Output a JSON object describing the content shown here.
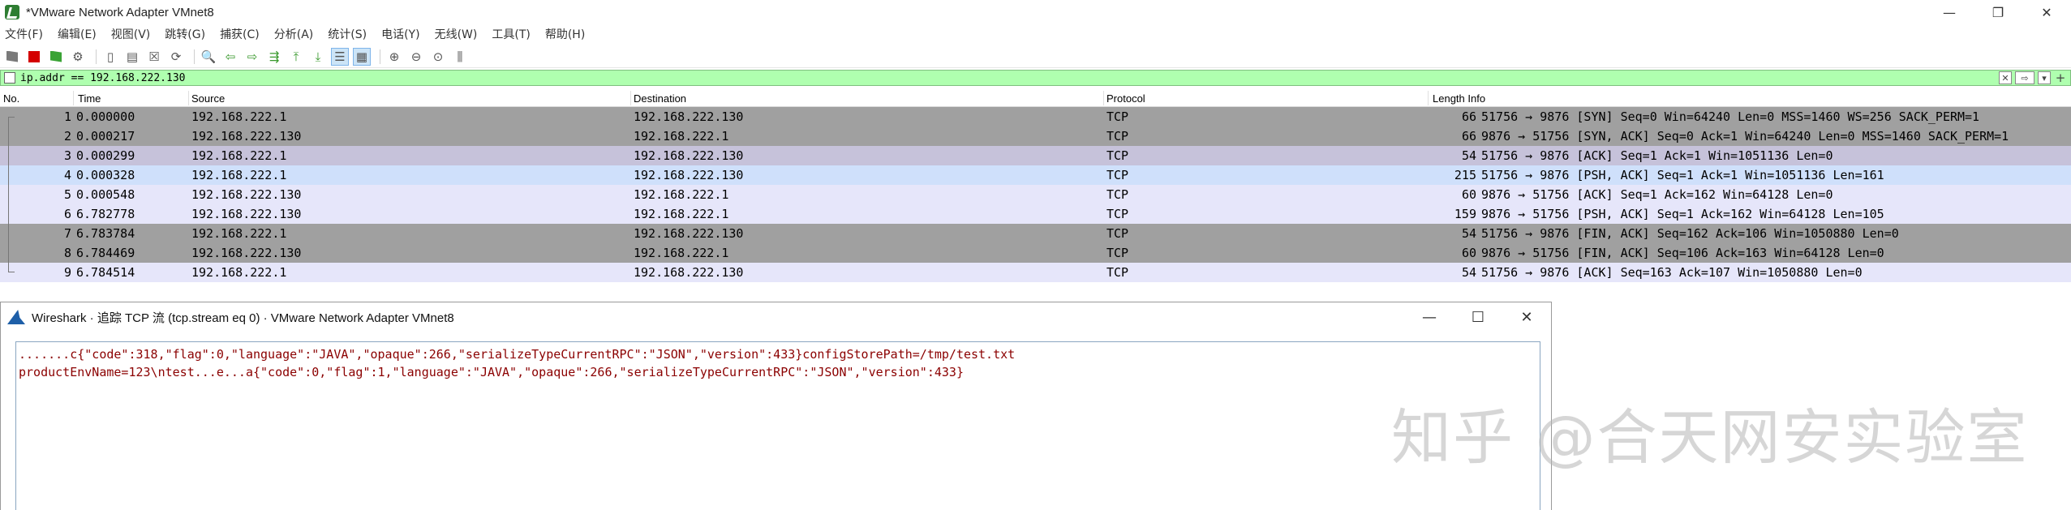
{
  "window": {
    "title": "*VMware Network Adapter VMnet8",
    "controls": [
      "—",
      "❐",
      "✕"
    ]
  },
  "menu": [
    "文件(F)",
    "编辑(E)",
    "视图(V)",
    "跳转(G)",
    "捕获(C)",
    "分析(A)",
    "统计(S)",
    "电话(Y)",
    "无线(W)",
    "工具(T)",
    "帮助(H)"
  ],
  "toolbar": {
    "icons": [
      "shark-fin-icon",
      "stop-icon",
      "restart-icon",
      "options-icon",
      "open-icon",
      "save-icon",
      "close-file-icon",
      "reload-icon",
      "find-icon",
      "back-icon",
      "forward-icon",
      "goto-icon",
      "first-icon",
      "last-icon",
      "autoscroll-icon",
      "colorize-icon",
      "zoom-in-icon",
      "zoom-out-icon",
      "zoom-reset-icon",
      "resize-columns-icon"
    ]
  },
  "filter": {
    "value": "ip.addr == 192.168.222.130"
  },
  "columns": {
    "no": "No.",
    "time": "Time",
    "source": "Source",
    "destination": "Destination",
    "protocol": "Protocol",
    "length_info": "Length Info"
  },
  "packets": [
    {
      "no": "1",
      "time": "0.000000",
      "source": "192.168.222.1",
      "destination": "192.168.222.130",
      "protocol": "TCP",
      "length": "66",
      "info": "51756 → 9876 [SYN] Seq=0 Win=64240 Len=0 MSS=1460 WS=256 SACK_PERM=1",
      "bg": "#a0a0a0"
    },
    {
      "no": "2",
      "time": "0.000217",
      "source": "192.168.222.130",
      "destination": "192.168.222.1",
      "protocol": "TCP",
      "length": "66",
      "info": "9876 → 51756 [SYN, ACK] Seq=0 Ack=1 Win=64240 Len=0 MSS=1460 SACK_PERM=1",
      "bg": "#a0a0a0"
    },
    {
      "no": "3",
      "time": "0.000299",
      "source": "192.168.222.1",
      "destination": "192.168.222.130",
      "protocol": "TCP",
      "length": "54",
      "info": "51756 → 9876 [ACK] Seq=1 Ack=1 Win=1051136 Len=0",
      "bg": "#c6c2da"
    },
    {
      "no": "4",
      "time": "0.000328",
      "source": "192.168.222.1",
      "destination": "192.168.222.130",
      "protocol": "TCP",
      "length": "215",
      "info": "51756 → 9876 [PSH, ACK] Seq=1 Ack=1 Win=1051136 Len=161",
      "bg": "#cfe0fb"
    },
    {
      "no": "5",
      "time": "0.000548",
      "source": "192.168.222.130",
      "destination": "192.168.222.1",
      "protocol": "TCP",
      "length": "60",
      "info": "9876 → 51756 [ACK] Seq=1 Ack=162 Win=64128 Len=0",
      "bg": "#e6e6fa"
    },
    {
      "no": "6",
      "time": "6.782778",
      "source": "192.168.222.130",
      "destination": "192.168.222.1",
      "protocol": "TCP",
      "length": "159",
      "info": "9876 → 51756 [PSH, ACK] Seq=1 Ack=162 Win=64128 Len=105",
      "bg": "#e6e6fa"
    },
    {
      "no": "7",
      "time": "6.783784",
      "source": "192.168.222.1",
      "destination": "192.168.222.130",
      "protocol": "TCP",
      "length": "54",
      "info": "51756 → 9876 [FIN, ACK] Seq=162 Ack=106 Win=1050880 Len=0",
      "bg": "#a0a0a0"
    },
    {
      "no": "8",
      "time": "6.784469",
      "source": "192.168.222.130",
      "destination": "192.168.222.1",
      "protocol": "TCP",
      "length": "60",
      "info": "9876 → 51756 [FIN, ACK] Seq=106 Ack=163 Win=64128 Len=0",
      "bg": "#a0a0a0"
    },
    {
      "no": "9",
      "time": "6.784514",
      "source": "192.168.222.1",
      "destination": "192.168.222.130",
      "protocol": "TCP",
      "length": "54",
      "info": "51756 → 9876 [ACK] Seq=163 Ack=107 Win=1050880 Len=0",
      "bg": "#e6e6fa"
    }
  ],
  "dialog": {
    "title": "Wireshark · 追踪 TCP 流 (tcp.stream eq 0) · VMware Network Adapter VMnet8",
    "controls": [
      "—",
      "☐",
      "✕"
    ],
    "stream_lines": [
      ".......c{\"code\":318,\"flag\":0,\"language\":\"JAVA\",\"opaque\":266,\"serializeTypeCurrentRPC\":\"JSON\",\"version\":433}configStorePath=/tmp/test.txt",
      "productEnvName=123\\ntest...e...a{\"code\":0,\"flag\":1,\"language\":\"JAVA\",\"opaque\":266,\"serializeTypeCurrentRPC\":\"JSON\",\"version\":433}"
    ]
  },
  "watermark": "知乎 @合天网安实验室"
}
